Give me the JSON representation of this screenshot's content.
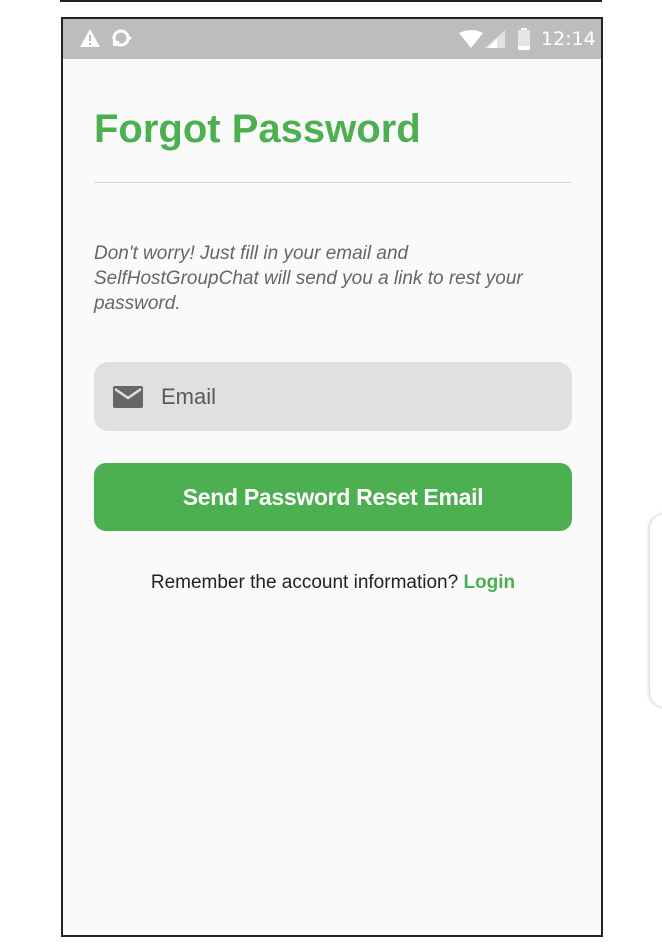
{
  "status_bar": {
    "time": "12:14",
    "icons": [
      "warning-icon",
      "sync-icon",
      "wifi-icon",
      "signal-icon",
      "battery-icon"
    ],
    "background": "#bdbdbd"
  },
  "page": {
    "title": "Forgot Password",
    "description": "Don't worry! Just fill in your email and SelfHostGroupChat will send you a link to rest your password."
  },
  "form": {
    "email_placeholder": "Email",
    "email_icon": "mail-icon",
    "submit_label": "Send Password Reset Email"
  },
  "footer": {
    "prompt": "Remember the account information?",
    "login_label": "Login"
  },
  "colors": {
    "accent": "#4caf50",
    "field_background": "#e0e0e2",
    "page_background": "#fafafa"
  }
}
